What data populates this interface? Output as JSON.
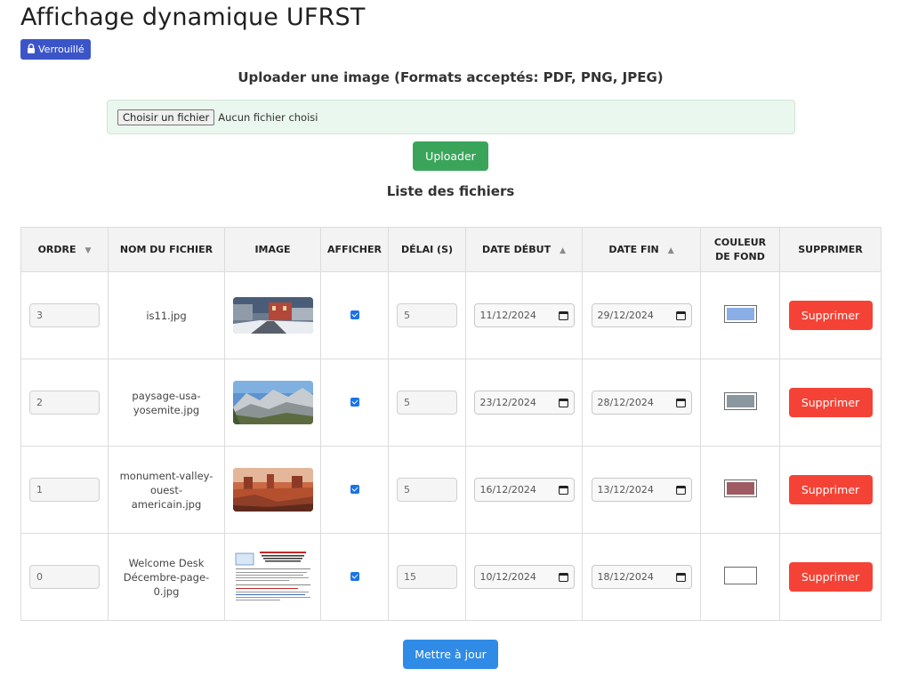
{
  "page": {
    "title": "Affichage dynamique UFRST",
    "lock_label": "Verrouillé",
    "upload_title": "Uploader une image (Formats acceptés: PDF, PNG, JPEG)",
    "file_button_label": "Choisir un fichier",
    "file_status": "Aucun fichier choisi",
    "upload_button_label": "Uploader",
    "list_title": "Liste des fichiers",
    "update_button_label": "Mettre à jour"
  },
  "table": {
    "headers": {
      "order": "ORDRE",
      "filename": "NOM DU FICHIER",
      "image": "IMAGE",
      "show": "AFFICHER",
      "delay": "DÉLAI (S)",
      "start": "DATE DÉBUT",
      "end": "DATE FIN",
      "color_line1": "COULEUR",
      "color_line2": "DE FOND",
      "delete": "SUPPRIMER"
    },
    "rows": [
      {
        "order": "3",
        "filename_lines": [
          "is11.jpg"
        ],
        "show": true,
        "delay": "5",
        "start": "11/12/2024",
        "end": "29/12/2024",
        "color": "#8aaee6",
        "delete_label": "Supprimer",
        "image": "snowy-street"
      },
      {
        "order": "2",
        "filename_lines": [
          "paysage-usa-",
          "yosemite.jpg"
        ],
        "show": true,
        "delay": "5",
        "start": "23/12/2024",
        "end": "28/12/2024",
        "color": "#8a979e",
        "delete_label": "Supprimer",
        "image": "mountain-valley"
      },
      {
        "order": "1",
        "filename_lines": [
          "monument-valley-",
          "ouest-americain.jpg"
        ],
        "show": true,
        "delay": "5",
        "start": "16/12/2024",
        "end": "13/12/2024",
        "color": "#9e5c62",
        "delete_label": "Supprimer",
        "image": "desert-canyon"
      },
      {
        "order": "0",
        "filename_lines": [
          "Welcome Desk",
          "Décembre-page-",
          "0.jpg"
        ],
        "show": true,
        "delay": "15",
        "start": "10/12/2024",
        "end": "18/12/2024",
        "color": "#ffffff",
        "delete_label": "Supprimer",
        "image": "document-page"
      }
    ]
  },
  "colors": {
    "lock_badge": "#3b55c9",
    "upload_button": "#3aa55a",
    "delete_button": "#f44336",
    "update_button": "#2f8be6"
  }
}
